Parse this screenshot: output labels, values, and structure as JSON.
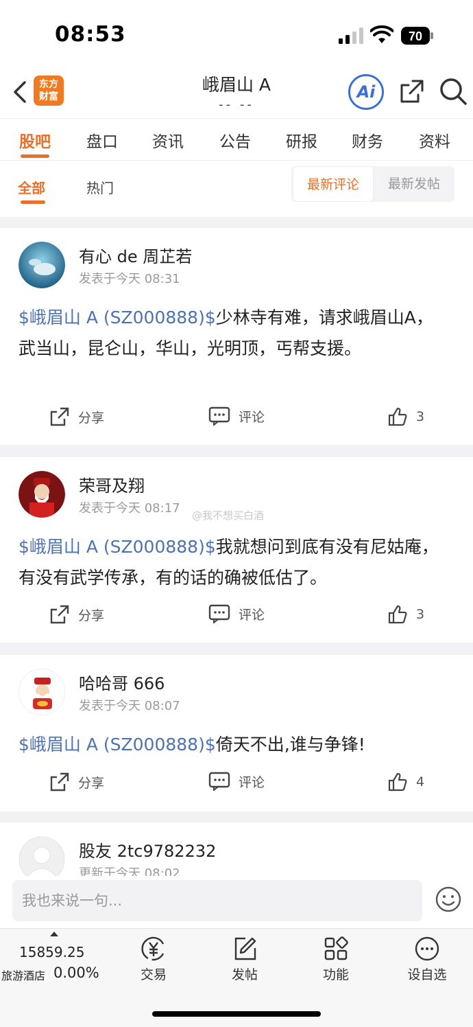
{
  "status_bar": {
    "time": "08:53",
    "battery": "70"
  },
  "header": {
    "back_label": "<",
    "logo_text_line1": "东方",
    "logo_text_line2": "财富",
    "title": "峨眉山 A",
    "subtitle": "-- --",
    "ai_label": "Ai"
  },
  "tabs": [
    {
      "label": "股吧",
      "active": true
    },
    {
      "label": "盘口"
    },
    {
      "label": "资讯"
    },
    {
      "label": "公告"
    },
    {
      "label": "研报"
    },
    {
      "label": "财务"
    },
    {
      "label": "资料"
    }
  ],
  "subtabs": [
    {
      "label": "全部",
      "active": true
    },
    {
      "label": "热门"
    }
  ],
  "sort": {
    "active": "最新评论",
    "inactive": "最新发帖"
  },
  "posts": [
    {
      "username": "有心 de 周芷若",
      "time": "发表于今天 08:31",
      "tag": "$峨眉山 A (SZ000888)$",
      "text": "少林寺有难，请求峨眉山A，武当山，昆仑山，华山，光明顶，丐帮支援。",
      "share": "分享",
      "comment": "评论",
      "likes": "3"
    },
    {
      "username": "荣哥及翔",
      "time": "发表于今天 08:17",
      "tag": "$峨眉山 A (SZ000888)$",
      "text": "我就想问到底有没有尼姑庵，有没有武学传承，有的话的确被低估了。",
      "share": "分享",
      "comment": "评论",
      "likes": "3"
    },
    {
      "username": "哈哈哥 666",
      "time": "发表于今天 08:07",
      "tag": "$峨眉山 A (SZ000888)$",
      "text": "倚天不出,谁与争锋!",
      "share": "分享",
      "comment": "评论",
      "likes": "4"
    },
    {
      "username": "股友 2tc9782232",
      "time": "更新于今天 08:02"
    }
  ],
  "watermark": "@我不想买白酒",
  "input": {
    "placeholder": "我也来说一句..."
  },
  "bottom_nav": {
    "index_value": "15859.25",
    "index_name": "旅游酒店",
    "index_change": "0.00%",
    "items": [
      {
        "label": "交易",
        "icon": "yen-cycle-icon"
      },
      {
        "label": "发帖",
        "icon": "edit-icon"
      },
      {
        "label": "功能",
        "icon": "grid-icon"
      },
      {
        "label": "设自选",
        "icon": "more-circle-icon"
      }
    ]
  },
  "colors": {
    "accent": "#e8702a",
    "link": "#4d72b0",
    "ai": "#3a6fd8"
  }
}
